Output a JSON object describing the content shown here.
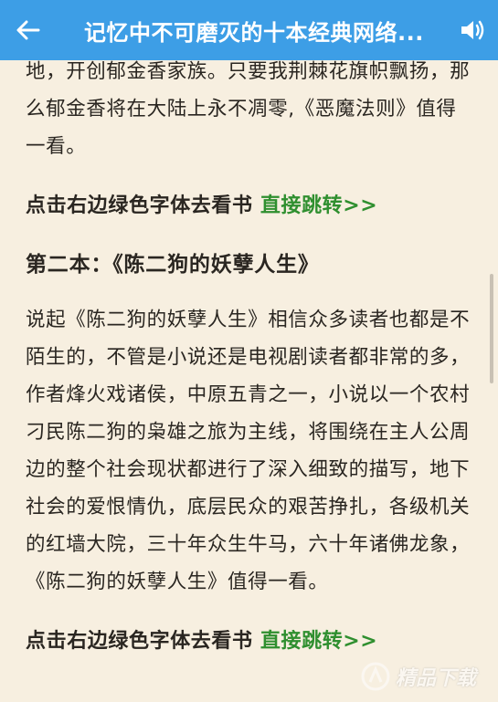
{
  "app_bar": {
    "title": "记忆中不可磨灭的十本经典网络...",
    "back_icon": "arrow-left-icon",
    "speaker_icon": "speaker-icon",
    "bg_color": "#3d9ee6"
  },
  "article": {
    "para_top": "地，开创郁金香家族。只要我荆棘花旗帜飘扬，那么郁金香将在大陆上永不凋零,《恶魔法则》值得一看。",
    "link1": {
      "text": "点击右边绿色字体去看书 ",
      "action": "直接跳转>>"
    },
    "heading2": "第二本：《陈二狗的妖孽人生》",
    "para2": "说起《陈二狗的妖孽人生》相信众多读者也都是不陌生的，不管是小说还是电视剧读者都非常的多，作者烽火戏诸侯，中原五青之一，小说以一个农村刁民陈二狗的枭雄之旅为主线，将围绕在主人公周边的整个社会现状都进行了深入细致的描写，地下社会的爱恨情仇，底层民众的艰苦挣扎，各级机关的红墙大院，三十年众生牛马，六十年诸佛龙象，《陈二狗的妖孽人生》值得一看。",
    "link2": {
      "text": "点击右边绿色字体去看书 ",
      "action": "直接跳转>>"
    }
  },
  "watermark": {
    "text": "精品下载"
  },
  "colors": {
    "background": "#f7efe0",
    "link_green": "#2f8f2f",
    "text": "#2a2621"
  }
}
